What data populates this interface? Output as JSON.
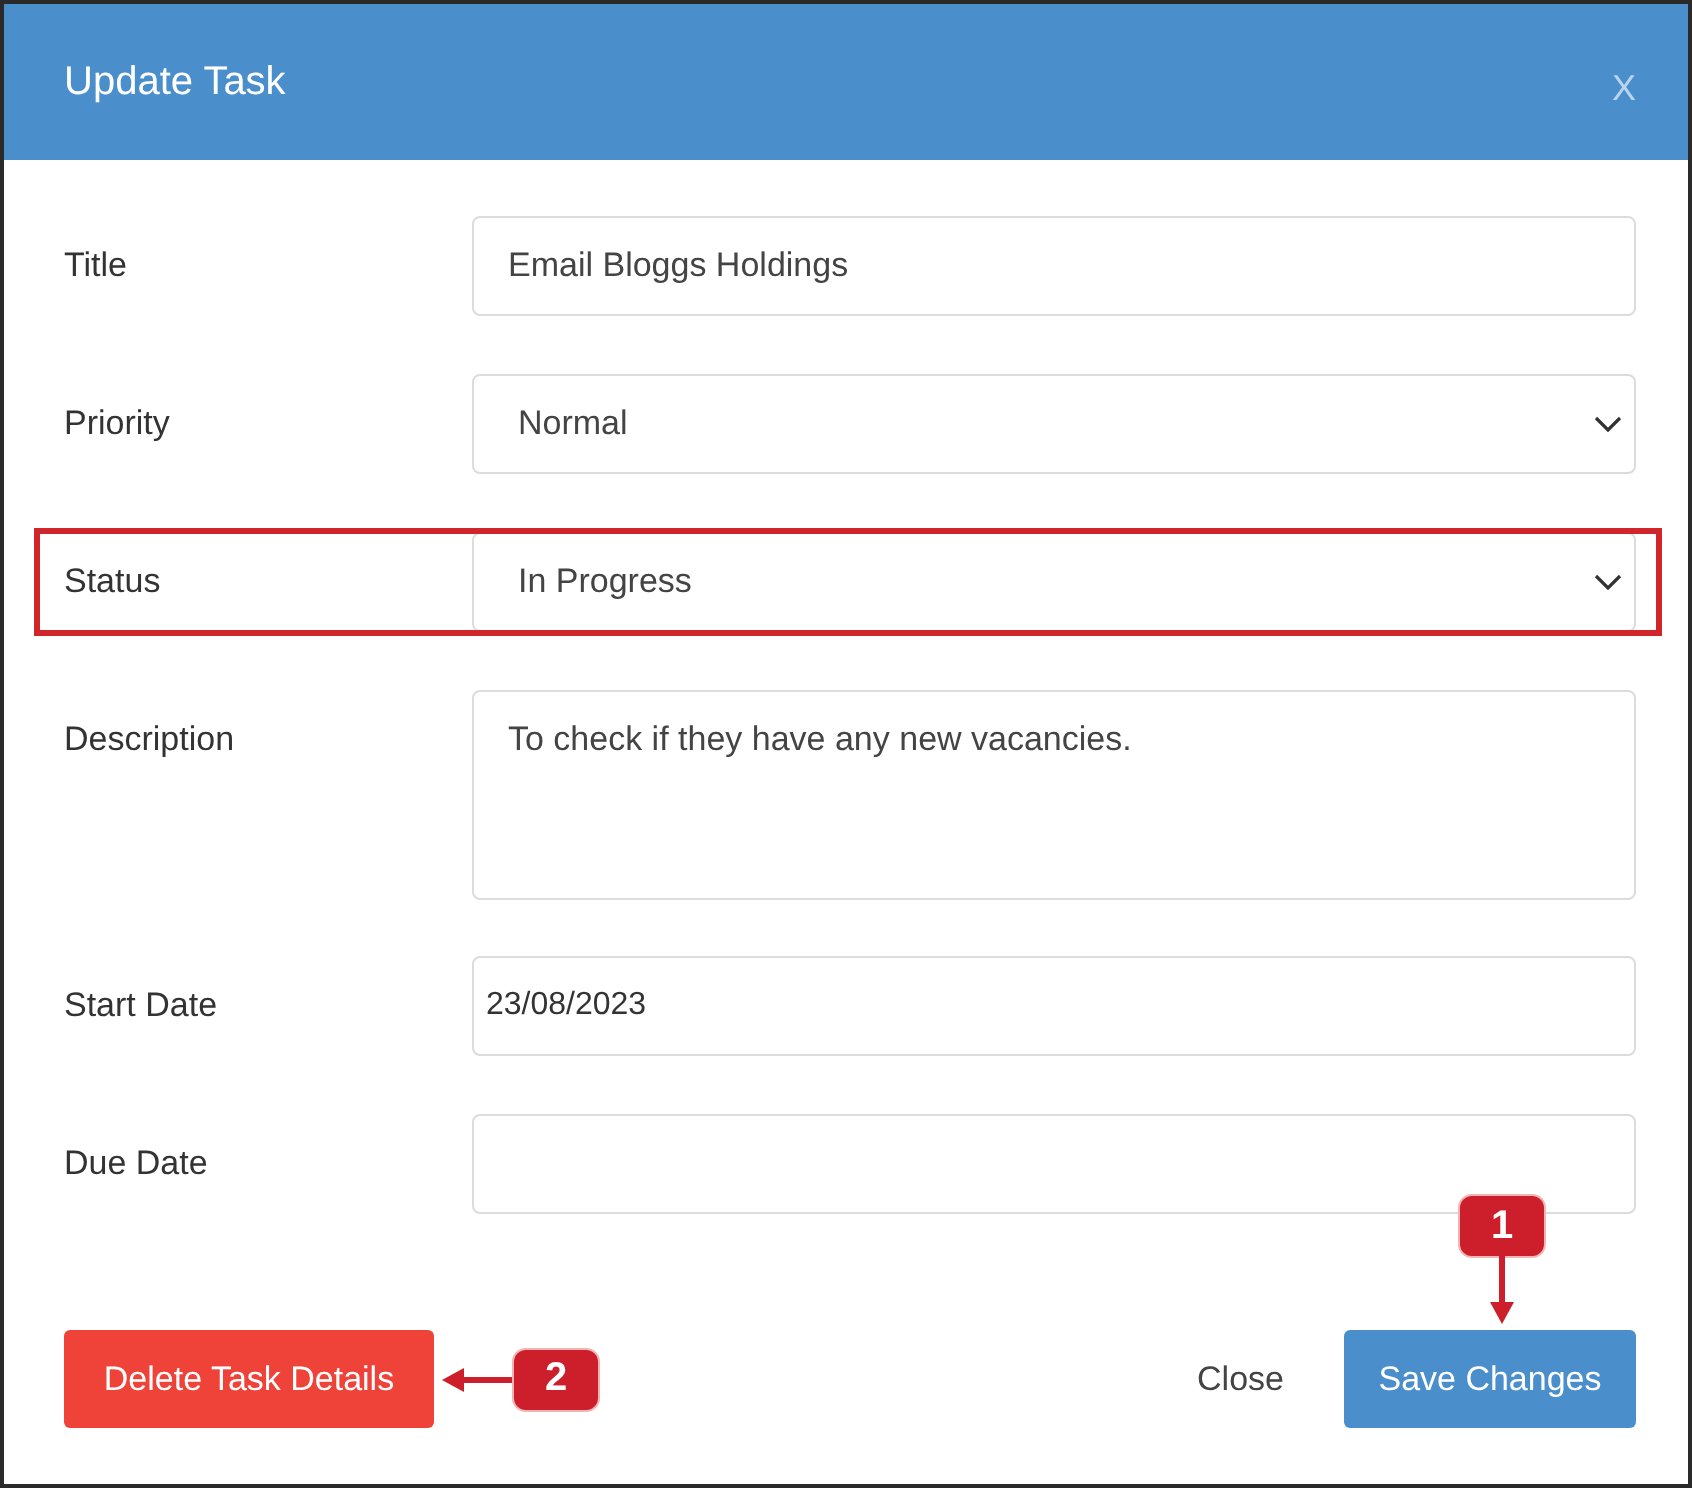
{
  "dialog": {
    "title": "Update Task",
    "close_label": "X"
  },
  "fields": [
    {
      "kind": "text",
      "label": "Title",
      "value": "Email Bloggs Holdings",
      "highlighted": false
    },
    {
      "kind": "select",
      "label": "Priority",
      "value": "Normal",
      "highlighted": false
    },
    {
      "kind": "select",
      "label": "Status",
      "value": "In Progress",
      "highlighted": true
    },
    {
      "kind": "textarea",
      "label": "Description",
      "value": "To check if they have any new vacancies.",
      "highlighted": false
    },
    {
      "kind": "date",
      "label": "Start Date",
      "value": "23/08/2023",
      "highlighted": false
    },
    {
      "kind": "date",
      "label": "Due Date",
      "highlighted": false
    }
  ],
  "buttons": [
    {
      "kind": "danger",
      "label": "Delete Task Details",
      "callout": {
        "kind": "left",
        "number": "2"
      }
    },
    {
      "kind": "link",
      "label": "Close"
    },
    {
      "kind": "primary",
      "label": "Save Changes",
      "callout": {
        "kind": "down",
        "number": "1"
      }
    }
  ]
}
